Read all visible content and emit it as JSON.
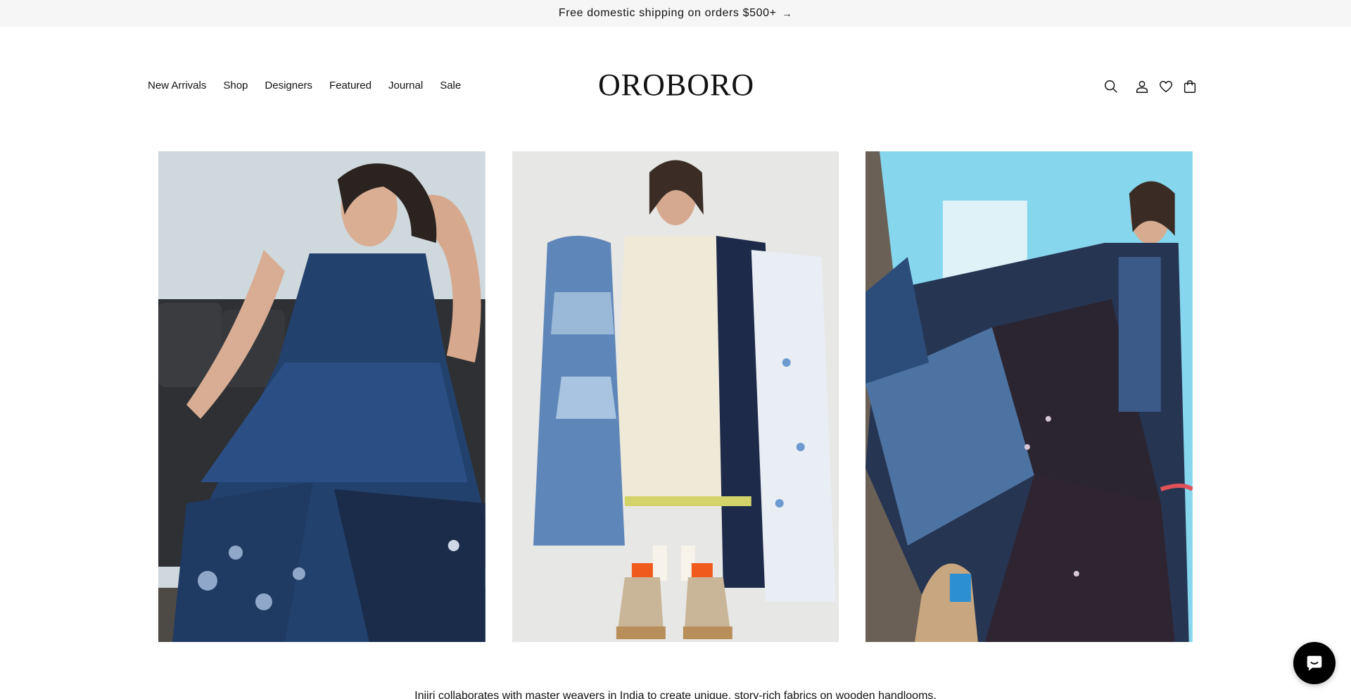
{
  "announcement": {
    "text": "Free domestic shipping on orders $500+",
    "arrow": "→"
  },
  "header": {
    "logo": "OROBORO",
    "nav": [
      "New Arrivals",
      "Shop",
      "Designers",
      "Featured",
      "Journal",
      "Sale"
    ],
    "icons": [
      "search-icon",
      "account-icon",
      "wishlist-heart-icon",
      "cart-icon"
    ]
  },
  "gallery": {
    "images": [
      {
        "name": "model-blue-indigo-dress-on-sofa"
      },
      {
        "name": "model-holding-textiles-cream-dress"
      },
      {
        "name": "model-patchwork-dress-on-blue-crate"
      }
    ]
  },
  "blurb": {
    "text": "Injiri collaborates with master weavers in India to create unique, story-rich fabrics on wooden handlooms."
  },
  "chat": {
    "icon": "chat-bubble-icon"
  },
  "colors": {
    "announcement_bg": "#f6f6f6",
    "text": "#121212",
    "chat_bg": "#000000"
  }
}
